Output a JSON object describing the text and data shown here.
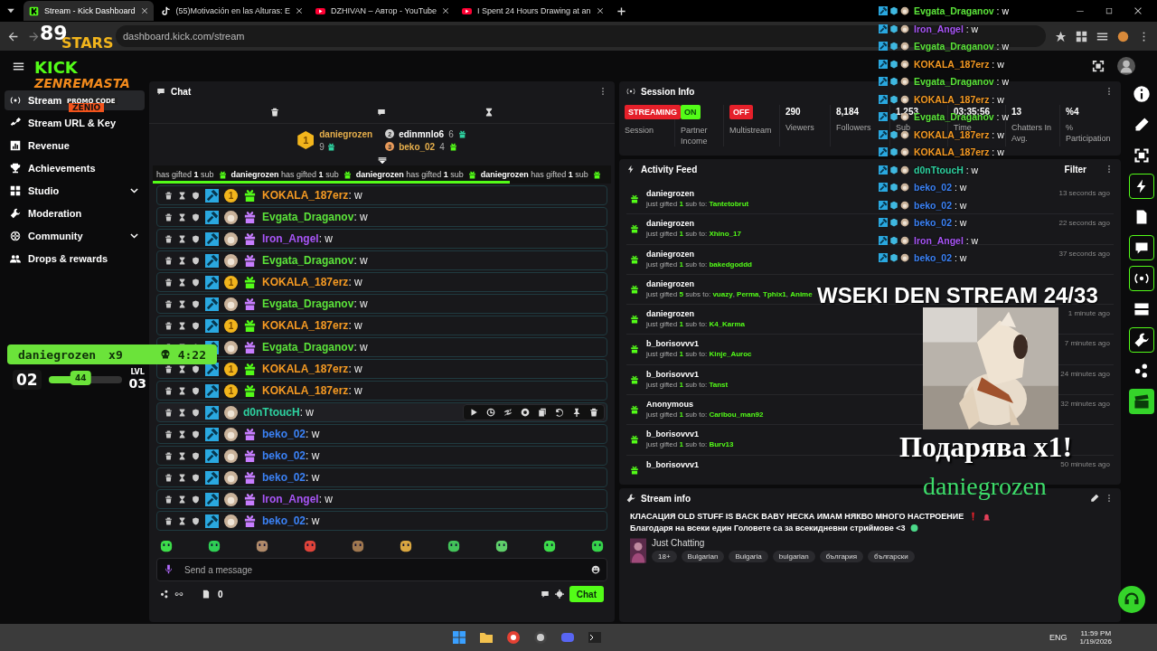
{
  "browser": {
    "tabs": [
      {
        "title": "Stream - Kick Dashboard",
        "selected": true
      },
      {
        "title": "(55)Motivación en las Alturas: E",
        "selected": false
      },
      {
        "title": "DZHIVAN – Автор - YouTube",
        "selected": false
      },
      {
        "title": "I Spent 24 Hours Drawing at an",
        "selected": false
      }
    ],
    "address": "dashboard.kick.com/stream"
  },
  "logo_overlay": {
    "number": "89",
    "stars": "STARS",
    "kick": "KICK",
    "name": "ZENREMASTA",
    "promo": "PROMO CODE",
    "code": "ZENIO"
  },
  "sidebar": {
    "items": [
      {
        "label": "Stream",
        "selected": true,
        "expandable": false
      },
      {
        "label": "Stream URL & Key",
        "selected": false,
        "expandable": false
      },
      {
        "label": "Revenue",
        "selected": false,
        "expandable": false
      },
      {
        "label": "Achievements",
        "selected": false,
        "expandable": false
      },
      {
        "label": "Studio",
        "selected": false,
        "expandable": true
      },
      {
        "label": "Moderation",
        "selected": false,
        "expandable": false
      },
      {
        "label": "Community",
        "selected": false,
        "expandable": true
      },
      {
        "label": "Drops & rewards",
        "selected": false,
        "expandable": false
      }
    ]
  },
  "goal_widget": {
    "name": "daniegrozen",
    "multiplier": "x9",
    "time": "4:22",
    "level_from": "02",
    "progress": "44",
    "level": 0.44,
    "lvl_label": "LVL",
    "level_to": "03"
  },
  "chat": {
    "title": "Chat",
    "leaders": [
      {
        "rank": "1",
        "name": "daniegrozen",
        "count": "9"
      },
      {
        "rank": "2",
        "name": "edinmnlo6",
        "count": "6"
      },
      {
        "rank": "3",
        "name": "beko_02",
        "count": "4"
      }
    ],
    "ticker": [
      "has gifted **1** sub",
      "**daniegrozen** has gifted **1** sub",
      "**daniegrozen** has gifted **1** sub",
      "**daniegrozen** has gifted **1** sub"
    ],
    "ticker_progress": {
      "level": 0.78
    },
    "messages": [
      {
        "name": "KOKALA_187erz",
        "text": ": w",
        "color": "#f59a23",
        "kind": "rank",
        "rank": "1",
        "gifted": true,
        "hovered": false
      },
      {
        "name": "Evgata_Draganov",
        "text": ": w",
        "color": "#5be33a",
        "kind": "avatar",
        "gifted": true,
        "hovered": false
      },
      {
        "name": "Iron_Angel",
        "text": ": w",
        "color": "#a855f7",
        "kind": "avatar",
        "gifted": true,
        "hovered": false
      },
      {
        "name": "Evgata_Draganov",
        "text": ": w",
        "color": "#5be33a",
        "kind": "avatar",
        "gifted": true,
        "hovered": false
      },
      {
        "name": "KOKALA_187erz",
        "text": ": w",
        "color": "#f59a23",
        "kind": "rank",
        "rank": "1",
        "gifted": true,
        "hovered": false
      },
      {
        "name": "Evgata_Draganov",
        "text": ": w",
        "color": "#5be33a",
        "kind": "avatar",
        "gifted": true,
        "hovered": false
      },
      {
        "name": "KOKALA_187erz",
        "text": ": w",
        "color": "#f59a23",
        "kind": "rank",
        "rank": "1",
        "gifted": true,
        "hovered": false
      },
      {
        "name": "Evgata_Draganov",
        "text": ": w",
        "color": "#5be33a",
        "kind": "avatar",
        "gifted": true,
        "hovered": false
      },
      {
        "name": "KOKALA_187erz",
        "text": ": w",
        "color": "#f59a23",
        "kind": "rank",
        "rank": "1",
        "gifted": true,
        "hovered": false
      },
      {
        "name": "KOKALA_187erz",
        "text": ": w",
        "color": "#f59a23",
        "kind": "rank",
        "rank": "1",
        "gifted": true,
        "hovered": false
      },
      {
        "name": "d0nTtoucH",
        "text": ": w",
        "color": "#2ed1a0",
        "kind": "avatar",
        "gifted": false,
        "hovered": true
      },
      {
        "name": "beko_02",
        "text": ": w",
        "color": "#3b82f6",
        "kind": "avatar",
        "gifted": true,
        "hovered": false
      },
      {
        "name": "beko_02",
        "text": ": w",
        "color": "#3b82f6",
        "kind": "avatar",
        "gifted": true,
        "hovered": false
      },
      {
        "name": "beko_02",
        "text": ": w",
        "color": "#3b82f6",
        "kind": "avatar",
        "gifted": true,
        "hovered": false
      },
      {
        "name": "Iron_Angel",
        "text": ": w",
        "color": "#a855f7",
        "kind": "avatar",
        "gifted": true,
        "hovered": false
      },
      {
        "name": "beko_02",
        "text": ": w",
        "color": "#3b82f6",
        "kind": "avatar",
        "gifted": true,
        "hovered": false
      }
    ],
    "input": {
      "placeholder": "Send a message"
    },
    "count": "0",
    "send": "Chat"
  },
  "session": {
    "title": "Session Info",
    "stats": [
      {
        "kind": "badge",
        "value": "STREAMING",
        "label": "Session",
        "color": "#e5202a"
      },
      {
        "kind": "badge",
        "value": "ON",
        "label": "Partner Income",
        "color": "#53fc18"
      },
      {
        "kind": "badge",
        "value": "OFF",
        "label": "Multistream",
        "color": "#e5202a"
      },
      {
        "kind": "number",
        "value": "290",
        "label": "Viewers"
      },
      {
        "kind": "number",
        "value": "8,184",
        "label": "Followers"
      },
      {
        "kind": "number",
        "value": "1,253",
        "label": "Sub"
      },
      {
        "kind": "number",
        "value": "03:35:56",
        "label": "Time"
      },
      {
        "kind": "number",
        "value": "13",
        "label": "Chatters In Avg."
      },
      {
        "kind": "number",
        "value": "%4",
        "label": "% Participation"
      }
    ]
  },
  "activity": {
    "title": "Activity Feed",
    "filter": "Filter",
    "items": [
      {
        "name": "daniegrozen",
        "line": "just gifted **1** sub to: **Tantetobrut**",
        "time": "13 seconds ago"
      },
      {
        "name": "daniegrozen",
        "line": "just gifted **1** sub to: **Xhino_17**",
        "time": "22 seconds ago"
      },
      {
        "name": "daniegrozen",
        "line": "just gifted **1** sub to: **bakedgoddd**",
        "time": "37 seconds ago"
      },
      {
        "name": "daniegrozen",
        "line": "just gifted **5** subs to: **vuazy**, **Perma**, **Tphix1**, **Anime**"
      },
      {
        "name": "daniegrozen",
        "line": "just gifted **1** sub to: **K4_Karma**",
        "time": "1 minute ago"
      },
      {
        "name": "b_borisovvv1",
        "line": "just gifted **1** sub to: **Kinje_Auroc**",
        "time": "7 minutes ago"
      },
      {
        "name": "b_borisovvv1",
        "line": "just gifted **1** sub to: **Tanst**",
        "time": "24 minutes ago"
      },
      {
        "name": "Anonymous",
        "line": "just gifted **1** sub to: **Caribou_man92**",
        "time": "32 minutes ago"
      },
      {
        "name": "b_borisovvv1",
        "line": "just gifted **1** sub to: **Burv13**"
      },
      {
        "name": "b_borisovvv1",
        "time": "50 minutes ago"
      }
    ]
  },
  "stream_info": {
    "title": "Stream info",
    "headline": [
      "КЛАСАЦИЯ OLD STUFF IS BACK BABY НЕСКА ИМАМ НЯКВО МНОГО НАСТРОЕНИЕ",
      "Благодаря на всеки един Головете са за всекидневни стриймове <3"
    ],
    "category": "Just Chatting",
    "tags": [
      "18+",
      "Bulgarian",
      "Bulgaria",
      "bulgarian",
      "българия",
      "български"
    ]
  },
  "overlay_chat": [
    {
      "name": "Evgata_Draganov",
      "text": ": w",
      "color": "#5be33a"
    },
    {
      "name": "Iron_Angel",
      "text": ": w",
      "color": "#a855f7"
    },
    {
      "name": "Evgata_Draganov",
      "text": ": w",
      "color": "#5be33a"
    },
    {
      "name": "KOKALA_187erz",
      "text": ": w",
      "color": "#f59a23"
    },
    {
      "name": "Evgata_Draganov",
      "text": ": w",
      "color": "#5be33a"
    },
    {
      "name": "KOKALA_187erz",
      "text": ": w",
      "color": "#f59a23"
    },
    {
      "name": "Evgata_Draganov",
      "text": ": w",
      "color": "#5be33a"
    },
    {
      "name": "KOKALA_187erz",
      "text": ": w",
      "color": "#f59a23"
    },
    {
      "name": "KOKALA_187erz",
      "text": ": w",
      "color": "#f59a23"
    },
    {
      "name": "d0nTtoucH",
      "text": ": w",
      "color": "#2ed1a0"
    },
    {
      "name": "beko_02",
      "text": ": w",
      "color": "#3b82f6"
    },
    {
      "name": "beko_02",
      "text": ": w",
      "color": "#3b82f6"
    },
    {
      "name": "beko_02",
      "text": ": w",
      "color": "#3b82f6"
    },
    {
      "name": "Iron_Angel",
      "text": ": w",
      "color": "#a855f7"
    },
    {
      "name": "beko_02",
      "text": ": w",
      "color": "#3b82f6"
    }
  ],
  "stream_overlay": {
    "headline": "WSEKI DEN STREAM 24/33",
    "alert": "Подарява x1!",
    "alert_name": "daniegrozen"
  },
  "taskbar": {
    "language": "ENG",
    "time": "11:59 PM",
    "date": "1/19/2026"
  }
}
